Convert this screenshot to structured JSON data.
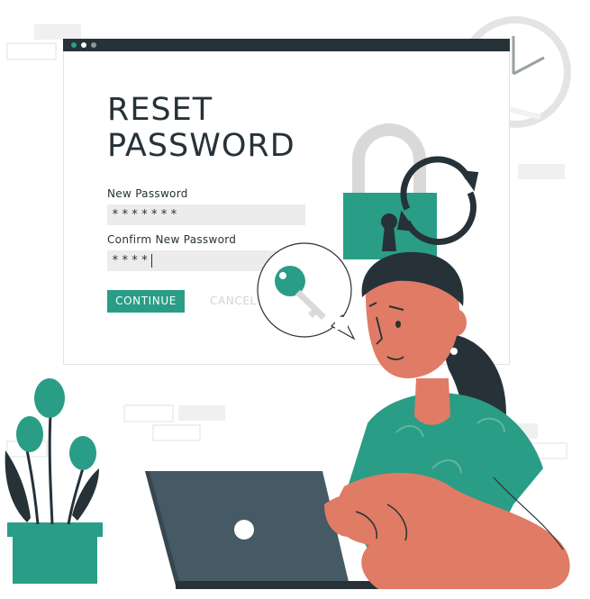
{
  "form": {
    "title_line1": "RESET",
    "title_line2": "PASSWORD",
    "new_password_label": "New Password",
    "new_password_value": "*******",
    "confirm_password_label": "Confirm New Password",
    "confirm_password_value": "****",
    "continue_label": "CONTINUE",
    "cancel_label": "CANCEL"
  },
  "colors": {
    "accent": "#2a9d86",
    "dark": "#263238",
    "skin": "#e07b65",
    "field": "#ececec"
  },
  "icons": [
    "padlock-icon",
    "refresh-icon",
    "key-icon",
    "clock-icon",
    "laptop-icon"
  ]
}
